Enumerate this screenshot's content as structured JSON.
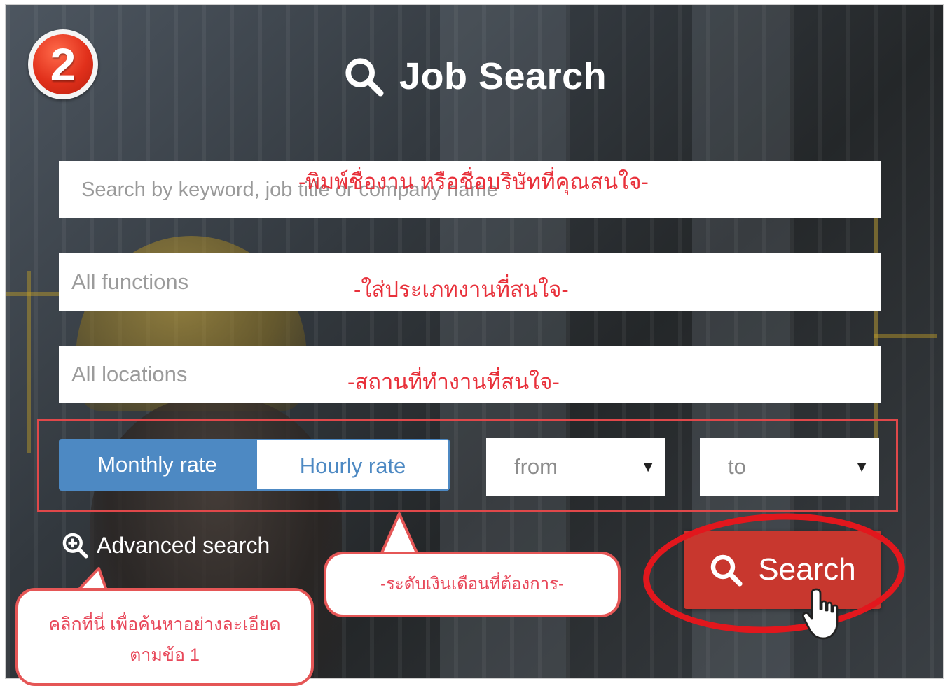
{
  "step_badge": "2",
  "header": {
    "title": "Job Search"
  },
  "fields": {
    "keyword_placeholder": "Search by keyword, job title or company name",
    "functions": "All functions",
    "locations": "All locations"
  },
  "notes": {
    "keyword": "-พิมพ์ชื่องาน หรือชื่อบริษัทที่คุณสนใจ-",
    "functions": "-ใส่ประเภทงานที่สนใจ-",
    "locations": "-สถานที่ทำงานที่สนใจ-",
    "salary": "-ระดับเงินเดือนที่ต้องการ-",
    "advanced_line1": "คลิกที่นี่ เพื่อค้นหาอย่างละเอียด",
    "advanced_line2": "ตามข้อ 1"
  },
  "rate": {
    "monthly": "Monthly rate",
    "hourly": "Hourly rate",
    "selected": "Monthly rate",
    "from": "from",
    "to": "to"
  },
  "advanced": {
    "label": "Advanced search"
  },
  "search": {
    "label": "Search"
  },
  "colors": {
    "accent_blue": "#4d89c3",
    "search_red": "#c8372e",
    "annotation_red": "#e2171d"
  },
  "icons": [
    "search-icon",
    "zoom-in-icon",
    "hand-cursor-icon",
    "caret-down-icon"
  ]
}
